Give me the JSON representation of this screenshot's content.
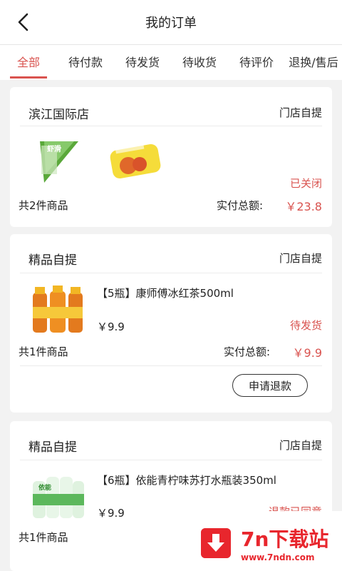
{
  "header": {
    "title": "我的订单",
    "back_icon": "chevron-left-icon"
  },
  "tabs": [
    {
      "label": "全部",
      "active": true
    },
    {
      "label": "待付款",
      "active": false
    },
    {
      "label": "待发货",
      "active": false
    },
    {
      "label": "待收货",
      "active": false
    },
    {
      "label": "待评价",
      "active": false
    },
    {
      "label": "退换/售后",
      "active": false
    }
  ],
  "orders": [
    {
      "shop": "滨江国际店",
      "mode": "门店自提",
      "status": "已关闭",
      "count_text": "共2件商品",
      "total_label": "实付总额:",
      "total_value": "￥23.8"
    },
    {
      "shop": "精品自提",
      "mode": "门店自提",
      "product_name": "【5瓶】康师傅冰红茶500ml",
      "price": "￥9.9",
      "status": "待发货",
      "count_text": "共1件商品",
      "total_label": "实付总额:",
      "total_value": "￥9.9",
      "action": "申请退款"
    },
    {
      "shop": "精品自提",
      "mode": "门店自提",
      "product_name": "【6瓶】依能青柠味苏打水瓶装350ml",
      "price": "￥9.9",
      "status": "退款已同意",
      "count_text": "共1件商品"
    }
  ],
  "product_images": {
    "snack_left": "虾滑",
    "bottle_green": "依能"
  },
  "watermark": {
    "title": "7n下载站",
    "url": "www.7ndn.com"
  },
  "colors": {
    "accent": "#d9534f",
    "watermark": "#e8262d"
  }
}
